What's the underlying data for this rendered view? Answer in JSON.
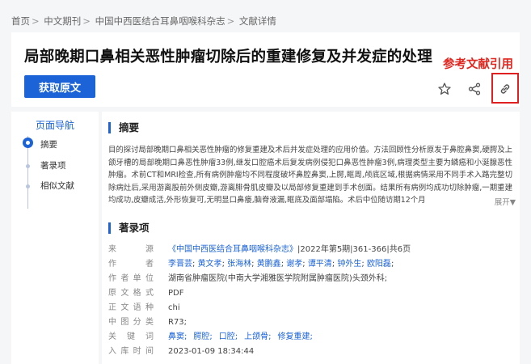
{
  "breadcrumb": {
    "items": [
      "首页",
      "中文期刊",
      "中国中西医结合耳鼻咽喉科杂志",
      "文献详情"
    ],
    "separator": ">"
  },
  "article": {
    "title": "局部晚期口鼻相关恶性肿瘤切除后的重建修复及并发症的处理",
    "get_button": "获取原文"
  },
  "annotation": {
    "text": "参考文献引用",
    "color": "#e0261f"
  },
  "toolbar": {
    "icons": [
      "star-icon",
      "share-icon",
      "link-icon"
    ]
  },
  "nav": {
    "title": "页面导航",
    "items": [
      "摘要",
      "著录项",
      "相似文献"
    ]
  },
  "abstract": {
    "heading": "摘要",
    "text": "目的探讨局部晚期口鼻相关恶性肿瘤的修复重建及术后并发症处理的应用价值。方法回顾性分析原发于鼻腔鼻窦,硬腭及上颌牙槽的局部晚期口鼻恶性肿瘤33例,继发口腔癌术后复发病例侵犯口鼻恶性肿瘤3例,病理类型主要为鳞癌和小涎腺恶性肿瘤。术前CT和MRI检查,所有病例肿瘤均不同程度破坏鼻腔鼻窦,上腭,眶周,颅底区域,根据病情采用不同手术入路完整切除病灶后,采用游离股前外侧皮瓣,游离腓骨肌皮瓣及以局部修复重建到手术创面。结果所有病例均成功切除肿瘤,一期重建均成功,皮瓣成活,外形恢复可,无明显口鼻瘘,脑脊液漏,眶底及面部塌陷。术后中位随访期12个月",
    "expand_label": "展开▼"
  },
  "record": {
    "heading": "著录项",
    "source": {
      "label": "来　源",
      "journal": "《中国中西医结合耳鼻咽喉科杂志》",
      "issue": "|2022年第5期|361-366|共6页"
    },
    "authors": {
      "label": "作　者",
      "names": [
        "李晋芸",
        "黄文孝",
        "张海林",
        "黄鹏鑫",
        "谢孝",
        "谭平清",
        "钟外生",
        "欧阳磊"
      ]
    },
    "affiliation": {
      "label": "作者单位",
      "value": "湖南省肿瘤医院(中南大学湘雅医学院附属肿瘤医院)头颈外科;"
    },
    "format": {
      "label": "原文格式",
      "value": "PDF"
    },
    "language": {
      "label": "正文语种",
      "value": "chi"
    },
    "clc": {
      "label": "中图分类",
      "value": "R73;"
    },
    "keywords": {
      "label": "关键词",
      "items": [
        "鼻窦;",
        "腭腔;",
        "口腔;",
        "上颌骨;",
        "修复重建;"
      ]
    },
    "date": {
      "label": "入库时间",
      "value": "2023-01-09 18:34:44"
    }
  },
  "colors": {
    "accent": "#1b63d6",
    "highlight": "#e02020"
  }
}
